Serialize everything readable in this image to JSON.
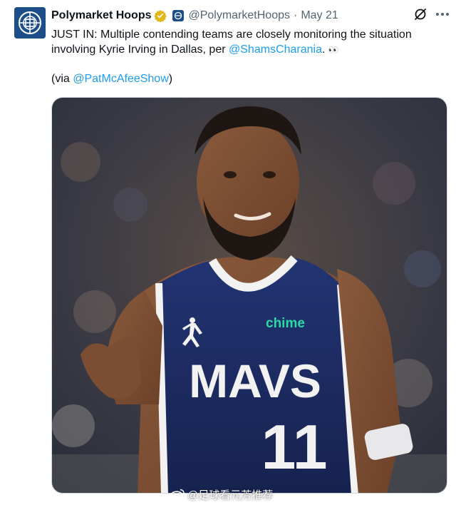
{
  "tweet": {
    "display_name": "Polymarket Hoops",
    "handle": "@PolymarketHoops",
    "separator": "·",
    "date": "May 21",
    "text_line1": "JUST IN: Multiple contending teams are closely monitoring the situation",
    "text_line2_prefix": "involving Kyrie Irving in Dallas, per ",
    "mention_shams": "@ShamsCharania",
    "text_line2_suffix": ".",
    "eyes": "👀",
    "via_prefix": "(via ",
    "mention_pat": "@PatMcAfeeShow",
    "via_suffix": ")"
  },
  "media": {
    "jersey_logo": "chime",
    "jersey_text": "MAVS",
    "jersey_number": "11"
  },
  "watermark": {
    "text": "@足球看元芳推荐"
  },
  "colors": {
    "link": "#1d9bf0",
    "secondary_text": "#536471",
    "verified_gold": "#e2b719",
    "jersey_navy": "#1b2a5e",
    "chime_green": "#2bd9a6"
  },
  "icons": [
    "polymarket-logo-icon",
    "verified-badge-icon",
    "affiliate-badge-icon",
    "grok-icon",
    "more-icon",
    "weibo-icon"
  ]
}
